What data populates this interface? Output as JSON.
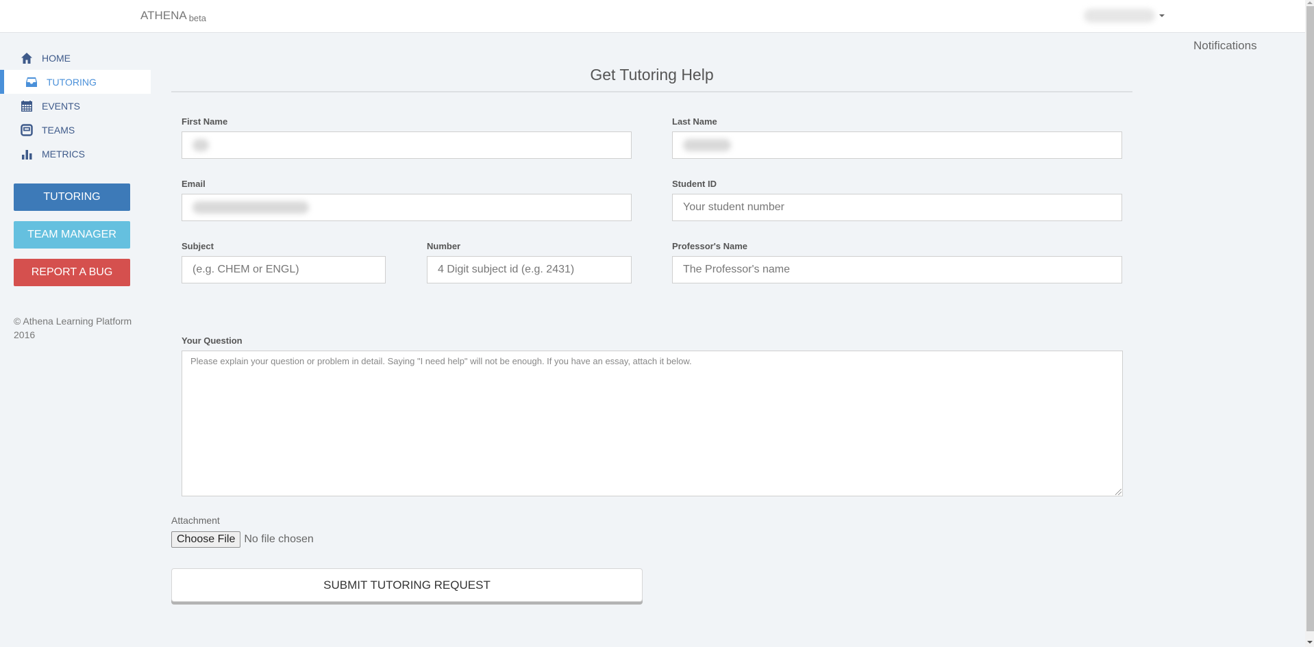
{
  "header": {
    "brand": "ATHENA",
    "brand_tag": "beta",
    "user_menu_name": "(blurred)",
    "notifications_label": "Notifications"
  },
  "sidebar": {
    "nav": [
      {
        "label": "HOME",
        "icon": "home-icon",
        "active": false
      },
      {
        "label": "TUTORING",
        "icon": "inbox-icon",
        "active": true
      },
      {
        "label": "EVENTS",
        "icon": "calendar-icon",
        "active": false
      },
      {
        "label": "TEAMS",
        "icon": "team-icon",
        "active": false
      },
      {
        "label": "METRICS",
        "icon": "bar-chart-icon",
        "active": false
      }
    ],
    "buttons": {
      "tutoring": "TUTORING",
      "team_manager": "TEAM MANAGER",
      "report_bug": "REPORT A BUG"
    },
    "copyright": "© Athena Learning Platform 2016"
  },
  "colors": {
    "primary": "#3d7ab8",
    "info": "#65c0df",
    "danger": "#d5504e",
    "active_nav": "#4a90d9",
    "nav_text": "#3e5a8a",
    "background": "#f1f4f7"
  },
  "form": {
    "title": "Get Tutoring Help",
    "first_name": {
      "label": "First Name",
      "value": "(blurred)"
    },
    "last_name": {
      "label": "Last Name",
      "value": "(blurred)"
    },
    "email": {
      "label": "Email",
      "value": "(blurred)"
    },
    "student_id": {
      "label": "Student ID",
      "placeholder": "Your student number"
    },
    "subject": {
      "label": "Subject",
      "placeholder": "(e.g. CHEM or ENGL)"
    },
    "number": {
      "label": "Number",
      "placeholder": "4 Digit subject id (e.g. 2431)"
    },
    "professor": {
      "label": "Professor's Name",
      "placeholder": "The Professor's name"
    },
    "question": {
      "label": "Your Question",
      "placeholder": "Please explain your question or problem in detail. Saying \"I need help\" will not be enough. If you have an essay, attach it below."
    },
    "attachment": {
      "label": "Attachment",
      "button": "Choose File",
      "status": "No file chosen"
    },
    "submit_label": "SUBMIT TUTORING REQUEST"
  }
}
